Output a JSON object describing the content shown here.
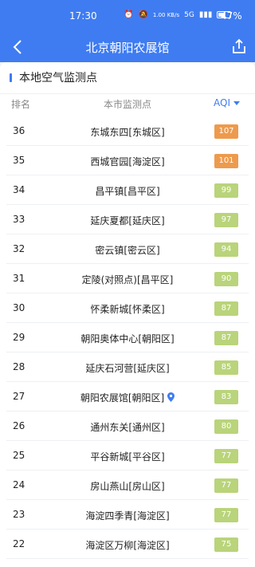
{
  "status_bar": {
    "time": "17:30",
    "network_speed": "1.00 KB/s",
    "signal": "5G",
    "battery": "47%"
  },
  "header": {
    "title": "北京朝阳农展馆"
  },
  "section": {
    "title": "本地空气监测点"
  },
  "columns": {
    "rank": "排名",
    "station": "本市监测点",
    "aqi": "AQI"
  },
  "colors": {
    "header_bg": "#3f7cf2",
    "aqi_orange": "#ee9a4d",
    "aqi_green": "#b9d47a"
  },
  "rows": [
    {
      "rank": "36",
      "station": "东城东四[东城区]",
      "aqi": "107",
      "level": "orange",
      "current": false
    },
    {
      "rank": "35",
      "station": "西城官园[海淀区]",
      "aqi": "101",
      "level": "orange",
      "current": false
    },
    {
      "rank": "34",
      "station": "昌平镇[昌平区]",
      "aqi": "99",
      "level": "green",
      "current": false
    },
    {
      "rank": "33",
      "station": "延庆夏都[延庆区]",
      "aqi": "97",
      "level": "green",
      "current": false
    },
    {
      "rank": "32",
      "station": "密云镇[密云区]",
      "aqi": "94",
      "level": "green",
      "current": false
    },
    {
      "rank": "31",
      "station": "定陵(对照点)[昌平区]",
      "aqi": "90",
      "level": "green",
      "current": false
    },
    {
      "rank": "30",
      "station": "怀柔新城[怀柔区]",
      "aqi": "87",
      "level": "green",
      "current": false
    },
    {
      "rank": "29",
      "station": "朝阳奥体中心[朝阳区]",
      "aqi": "87",
      "level": "green",
      "current": false
    },
    {
      "rank": "28",
      "station": "延庆石河营[延庆区]",
      "aqi": "85",
      "level": "green",
      "current": false
    },
    {
      "rank": "27",
      "station": "朝阳农展馆[朝阳区]",
      "aqi": "83",
      "level": "green",
      "current": true
    },
    {
      "rank": "26",
      "station": "通州东关[通州区]",
      "aqi": "80",
      "level": "green",
      "current": false
    },
    {
      "rank": "25",
      "station": "平谷新城[平谷区]",
      "aqi": "77",
      "level": "green",
      "current": false
    },
    {
      "rank": "24",
      "station": "房山燕山[房山区]",
      "aqi": "77",
      "level": "green",
      "current": false
    },
    {
      "rank": "23",
      "station": "海淀四季青[海淀区]",
      "aqi": "77",
      "level": "green",
      "current": false
    },
    {
      "rank": "22",
      "station": "海淀区万柳[海淀区]",
      "aqi": "75",
      "level": "green",
      "current": false
    }
  ]
}
